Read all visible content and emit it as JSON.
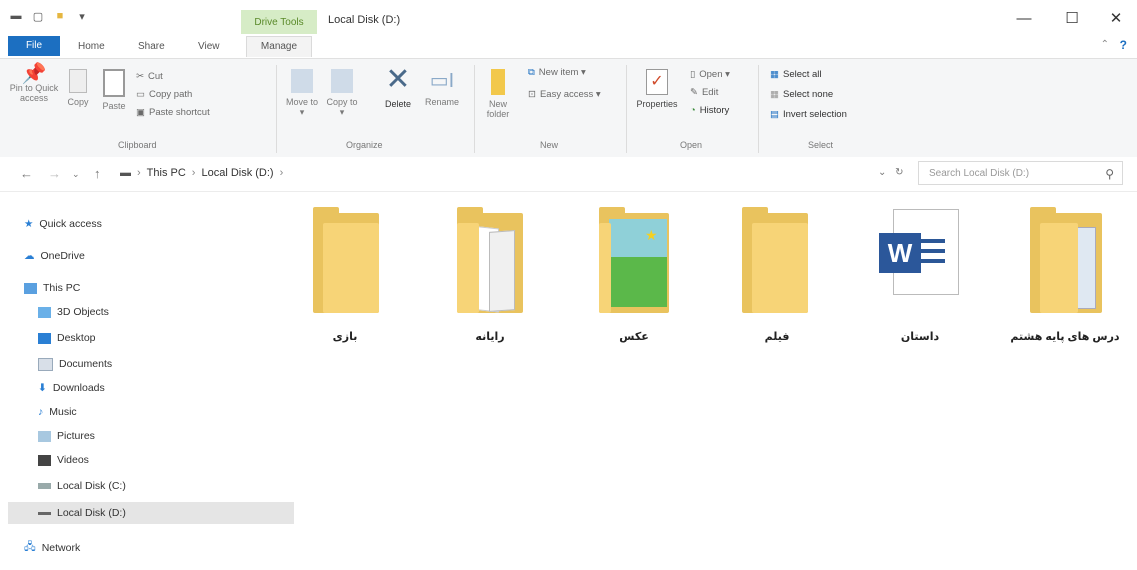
{
  "window": {
    "title": "Local Disk (D:)",
    "context_tab": "Drive Tools",
    "controls": {
      "minimize": "—",
      "maximize": "☐",
      "close": "✕"
    }
  },
  "tabs": {
    "file": "File",
    "home": "Home",
    "share": "Share",
    "view": "View",
    "manage": "Manage"
  },
  "ribbon": {
    "clipboard": {
      "pin": "Pin to Quick access",
      "copy": "Copy",
      "paste": "Paste",
      "cut": "Cut",
      "copy_path": "Copy path",
      "paste_shortcut": "Paste shortcut",
      "label": "Clipboard"
    },
    "organize": {
      "move_to": "Move to ▾",
      "copy_to": "Copy to ▾",
      "delete": "Delete",
      "rename": "Rename",
      "label": "Organize"
    },
    "new": {
      "new_folder": "New folder",
      "new_item": "New item ▾",
      "easy_access": "Easy access ▾",
      "label": "New"
    },
    "open": {
      "properties": "Properties",
      "open": "Open ▾",
      "edit": "Edit",
      "history": "History",
      "label": "Open"
    },
    "select": {
      "select_all": "Select all",
      "select_none": "Select none",
      "invert": "Invert selection",
      "label": "Select"
    }
  },
  "address": {
    "crumbs": [
      "This PC",
      "Local Disk (D:)"
    ],
    "search_placeholder": "Search Local Disk (D:)"
  },
  "nav": {
    "quick_access": "Quick access",
    "onedrive": "OneDrive",
    "this_pc": "This PC",
    "objects3d": "3D Objects",
    "desktop": "Desktop",
    "documents": "Documents",
    "downloads": "Downloads",
    "music": "Music",
    "pictures": "Pictures",
    "videos": "Videos",
    "local_c": "Local Disk (C:)",
    "local_d": "Local Disk (D:)",
    "network": "Network"
  },
  "items": [
    {
      "label": "بازی",
      "type": "folder"
    },
    {
      "label": "رایانه",
      "type": "folder"
    },
    {
      "label": "عکس",
      "type": "folder"
    },
    {
      "label": "فیلم",
      "type": "folder"
    },
    {
      "label": "داستان",
      "type": "word-document"
    },
    {
      "label": "درس های پایه هشتم",
      "type": "folder"
    }
  ],
  "colors": {
    "accent": "#1c6fc1",
    "context_tab_bg": "#d6ecc6",
    "folder": "#f7d477"
  }
}
